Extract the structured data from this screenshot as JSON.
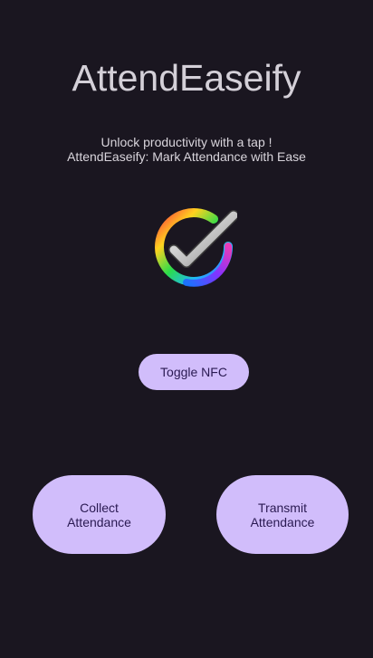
{
  "app": {
    "title": "AttendEaseify",
    "tagline_line1": "Unlock productivity with a tap !",
    "tagline_line2": "AttendEaseify: Mark Attendance with Ease",
    "logo_icon": "colorful-check-circle-icon"
  },
  "buttons": {
    "toggle_nfc": "Toggle NFC",
    "collect_line1": "Collect",
    "collect_line2": "Attendance",
    "transmit_line1": "Transmit",
    "transmit_line2": "Attendance"
  },
  "colors": {
    "background": "#1a1620",
    "button": "#d1bdfb",
    "button_text": "#2a1a52",
    "title_text": "#d4d0d8"
  }
}
